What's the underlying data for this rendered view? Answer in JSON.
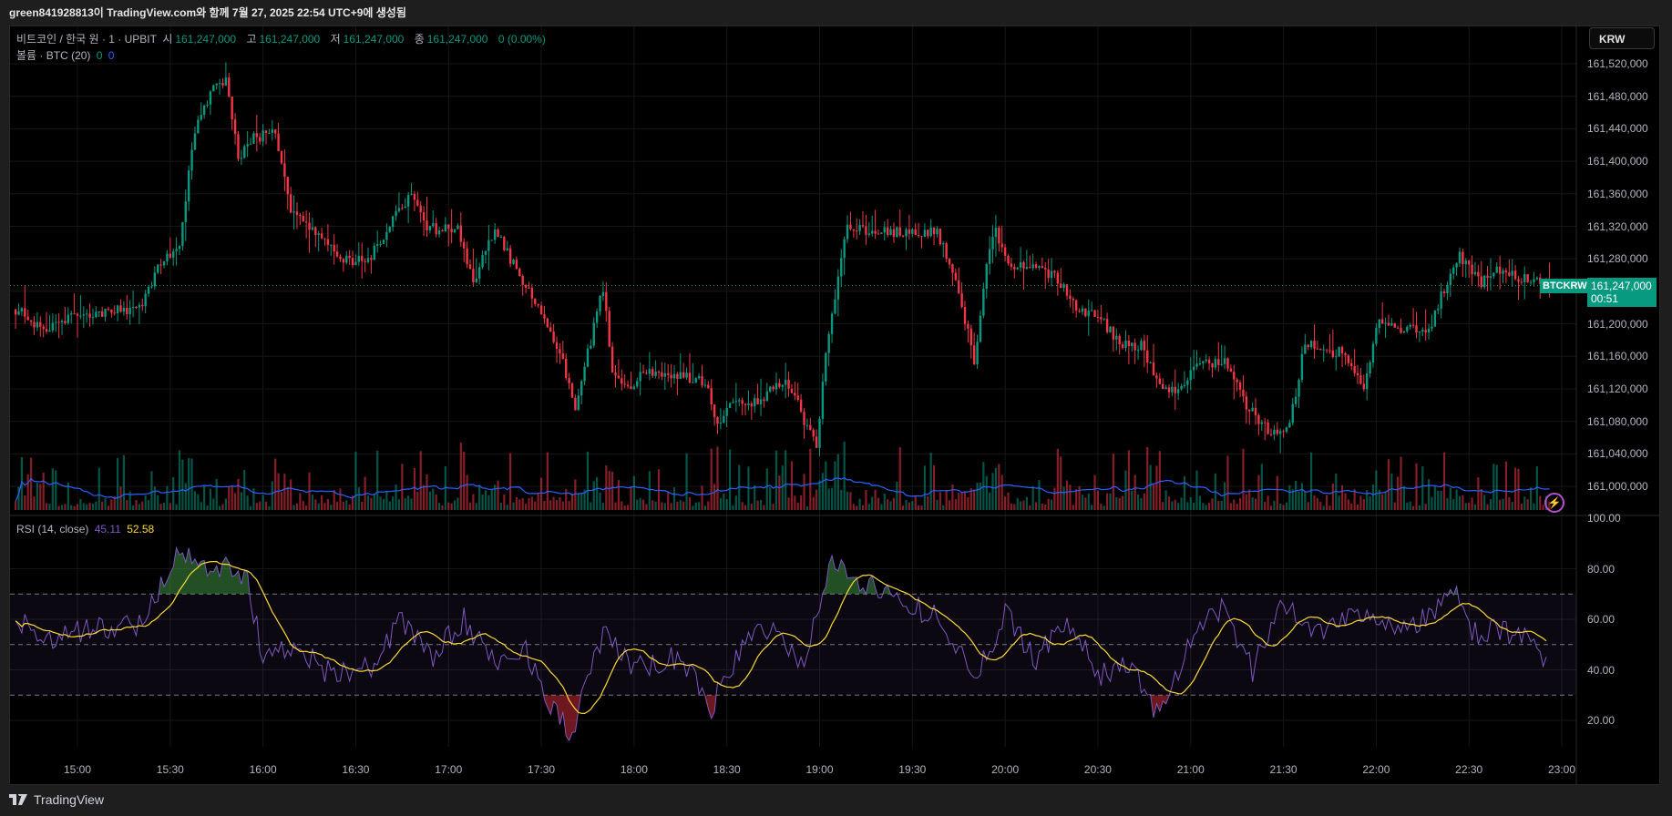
{
  "title_bar": "green841928813이 TradingView.com와 함께 7월 27, 2025 22:54 UTC+9에 생성됨",
  "legend": {
    "symbol": "비트코인 / 한국 원 · 1 · UPBIT",
    "open_label": "시",
    "open": "161,247,000",
    "high_label": "고",
    "high": "161,247,000",
    "low_label": "저",
    "low": "161,247,000",
    "close_label": "종",
    "close": "161,247,000",
    "change": "0 (0.00%)",
    "volume_label": "볼륨 · BTC (20)",
    "volume_a": "0",
    "volume_b": "0",
    "rsi_label": "RSI (14, close)",
    "rsi_value": "45.11",
    "rsi_ma_value": "52.58"
  },
  "currency_button": "KRW",
  "price_axis": [
    "161,520,000",
    "161,480,000",
    "161,440,000",
    "161,400,000",
    "161,360,000",
    "161,320,000",
    "161,280,000",
    "161,200,000",
    "161,160,000",
    "161,120,000",
    "161,080,000",
    "161,040,000",
    "161,000,000"
  ],
  "rsi_axis": [
    "100.00",
    "80.00",
    "60.00",
    "40.00",
    "20.00"
  ],
  "time_axis": [
    "15:00",
    "15:30",
    "16:00",
    "16:30",
    "17:00",
    "17:30",
    "18:00",
    "18:30",
    "19:00",
    "19:30",
    "20:00",
    "20:30",
    "21:00",
    "21:30",
    "22:00",
    "22:30",
    "23:00"
  ],
  "last_price": {
    "symbol": "BTCKRW",
    "price": "161,247,000",
    "countdown": "00:51"
  },
  "footer_brand": "TradingView",
  "colors": {
    "up": "#089981",
    "down": "#f23645",
    "rsi": "#7e57c2",
    "rsi_ma": "#fdd835",
    "volume_ma": "#2962ff"
  },
  "chart_data": {
    "type": "candlestick",
    "price_unit": "KRW (thousands above 161,000,000)",
    "price_points": [
      [
        "14:40",
        218
      ],
      [
        "14:50",
        192
      ],
      [
        "15:00",
        212
      ],
      [
        "15:20",
        218
      ],
      [
        "15:27",
        275
      ],
      [
        "15:33",
        297
      ],
      [
        "15:38",
        441
      ],
      [
        "15:44",
        487
      ],
      [
        "15:48",
        500
      ],
      [
        "15:52",
        402
      ],
      [
        "15:57",
        428
      ],
      [
        "16:04",
        435
      ],
      [
        "16:09",
        336
      ],
      [
        "16:16",
        317
      ],
      [
        "16:25",
        278
      ],
      [
        "16:34",
        278
      ],
      [
        "16:41",
        321
      ],
      [
        "16:48",
        363
      ],
      [
        "16:53",
        317
      ],
      [
        "17:03",
        317
      ],
      [
        "17:08",
        251
      ],
      [
        "17:15",
        317
      ],
      [
        "17:24",
        251
      ],
      [
        "17:31",
        205
      ],
      [
        "17:36",
        166
      ],
      [
        "17:41",
        100
      ],
      [
        "17:46",
        179
      ],
      [
        "17:50",
        244
      ],
      [
        "17:53",
        139
      ],
      [
        "17:59",
        113
      ],
      [
        "18:03",
        142
      ],
      [
        "18:12",
        137
      ],
      [
        "18:23",
        129
      ],
      [
        "18:27",
        74
      ],
      [
        "18:30",
        102
      ],
      [
        "18:40",
        102
      ],
      [
        "18:49",
        133
      ],
      [
        "18:53",
        100
      ],
      [
        "18:59",
        47
      ],
      [
        "19:02",
        166
      ],
      [
        "19:06",
        258
      ],
      [
        "19:09",
        317
      ],
      [
        "19:21",
        313
      ],
      [
        "19:38",
        313
      ],
      [
        "19:44",
        258
      ],
      [
        "19:50",
        153
      ],
      [
        "19:54",
        271
      ],
      [
        "19:57",
        317
      ],
      [
        "20:01",
        271
      ],
      [
        "20:11",
        268
      ],
      [
        "20:18",
        251
      ],
      [
        "20:23",
        218
      ],
      [
        "20:30",
        212
      ],
      [
        "20:36",
        179
      ],
      [
        "20:44",
        173
      ],
      [
        "20:51",
        120
      ],
      [
        "20:56",
        113
      ],
      [
        "21:01",
        153
      ],
      [
        "21:11",
        153
      ],
      [
        "21:18",
        100
      ],
      [
        "21:25",
        67
      ],
      [
        "21:32",
        74
      ],
      [
        "21:37",
        179
      ],
      [
        "21:44",
        166
      ],
      [
        "21:49",
        166
      ],
      [
        "21:56",
        126
      ],
      [
        "22:01",
        205
      ],
      [
        "22:07",
        195
      ],
      [
        "22:17",
        190
      ],
      [
        "22:22",
        244
      ],
      [
        "22:27",
        284
      ],
      [
        "22:34",
        251
      ],
      [
        "22:41",
        271
      ],
      [
        "22:46",
        258
      ],
      [
        "22:56",
        247
      ]
    ],
    "price_range": [
      160970,
      161540
    ],
    "rsi_points": [
      [
        "14:40",
        60
      ],
      [
        "14:50",
        52
      ],
      [
        "15:00",
        55
      ],
      [
        "15:20",
        58
      ],
      [
        "15:30",
        80
      ],
      [
        "15:33",
        88
      ],
      [
        "15:40",
        80
      ],
      [
        "15:48",
        82
      ],
      [
        "15:55",
        75
      ],
      [
        "16:00",
        45
      ],
      [
        "16:10",
        50
      ],
      [
        "16:20",
        40
      ],
      [
        "16:35",
        40
      ],
      [
        "16:45",
        60
      ],
      [
        "16:55",
        45
      ],
      [
        "17:05",
        60
      ],
      [
        "17:15",
        42
      ],
      [
        "17:25",
        48
      ],
      [
        "17:35",
        22
      ],
      [
        "17:40",
        15
      ],
      [
        "17:50",
        55
      ],
      [
        "18:00",
        40
      ],
      [
        "18:15",
        45
      ],
      [
        "18:25",
        25
      ],
      [
        "18:35",
        50
      ],
      [
        "18:45",
        58
      ],
      [
        "18:55",
        40
      ],
      [
        "19:03",
        82
      ],
      [
        "19:10",
        78
      ],
      [
        "19:25",
        68
      ],
      [
        "19:40",
        60
      ],
      [
        "19:50",
        35
      ],
      [
        "20:00",
        62
      ],
      [
        "20:10",
        45
      ],
      [
        "20:20",
        60
      ],
      [
        "20:30",
        38
      ],
      [
        "20:40",
        42
      ],
      [
        "20:50",
        22
      ],
      [
        "21:00",
        50
      ],
      [
        "21:10",
        65
      ],
      [
        "21:20",
        40
      ],
      [
        "21:30",
        67
      ],
      [
        "21:40",
        55
      ],
      [
        "21:50",
        62
      ],
      [
        "22:00",
        62
      ],
      [
        "22:10",
        55
      ],
      [
        "22:20",
        65
      ],
      [
        "22:25",
        72
      ],
      [
        "22:30",
        55
      ],
      [
        "22:45",
        55
      ],
      [
        "22:55",
        45
      ]
    ],
    "rsi_levels": [
      70,
      50,
      30
    ],
    "rsi_range": [
      0,
      100
    ]
  }
}
